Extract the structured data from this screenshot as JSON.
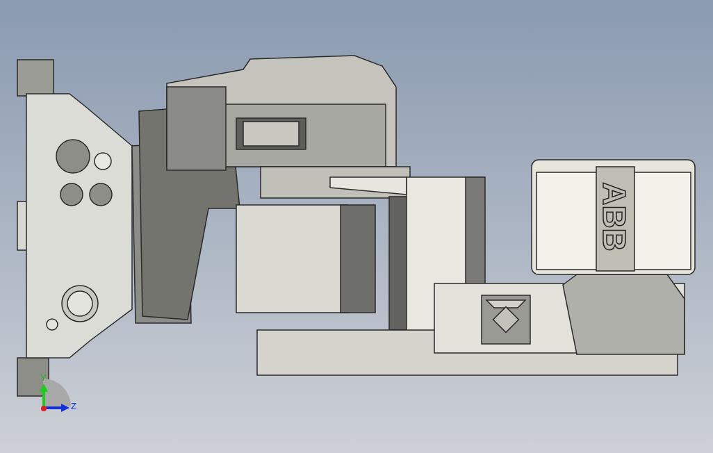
{
  "viewport": {
    "model_logo": "ABB",
    "axes": [
      {
        "kind": "y",
        "label": "Y"
      },
      {
        "kind": "z",
        "label": "Z"
      }
    ]
  }
}
